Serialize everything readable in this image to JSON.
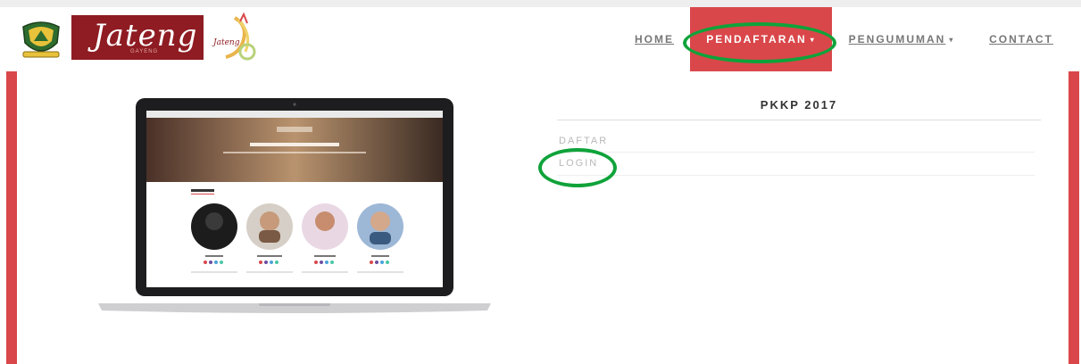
{
  "brand": {
    "name": "Jateng",
    "subtitle": "GAYENG"
  },
  "nav": {
    "items": [
      {
        "label": "HOME",
        "active": false,
        "dropdown": false
      },
      {
        "label": "PENDAFTARAN",
        "active": true,
        "dropdown": true
      },
      {
        "label": "PENGUMUMAN",
        "active": false,
        "dropdown": true
      },
      {
        "label": "CONTACT",
        "active": false,
        "dropdown": false
      }
    ],
    "caret": "▾"
  },
  "panel": {
    "title": "PKKP 2017",
    "links": [
      "DAFTAR",
      "LOGIN"
    ]
  },
  "colors": {
    "accent": "#d9474a",
    "brand": "#8e1c22",
    "highlight_ring": "#0fa33a"
  }
}
